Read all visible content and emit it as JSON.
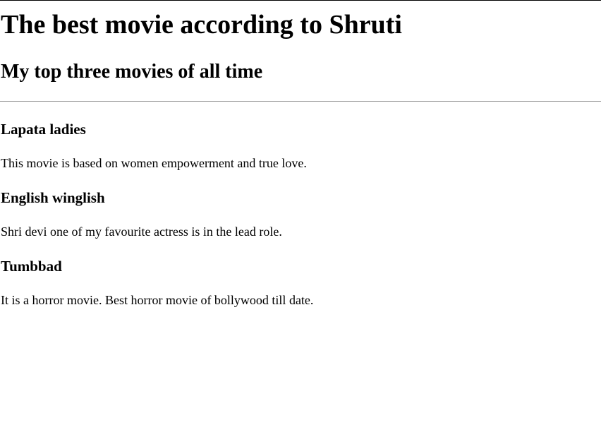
{
  "page": {
    "title": "The best movie according to Shruti",
    "subtitle": "My top three movies of all time"
  },
  "movies": [
    {
      "title": "Lapata ladies",
      "description": "This movie is based on women empowerment and true love."
    },
    {
      "title": "English winglish",
      "description": "Shri devi one of my favourite actress is in the lead role."
    },
    {
      "title": "Tumbbad",
      "description": "It is a horror movie. Best horror movie of bollywood till date."
    }
  ]
}
